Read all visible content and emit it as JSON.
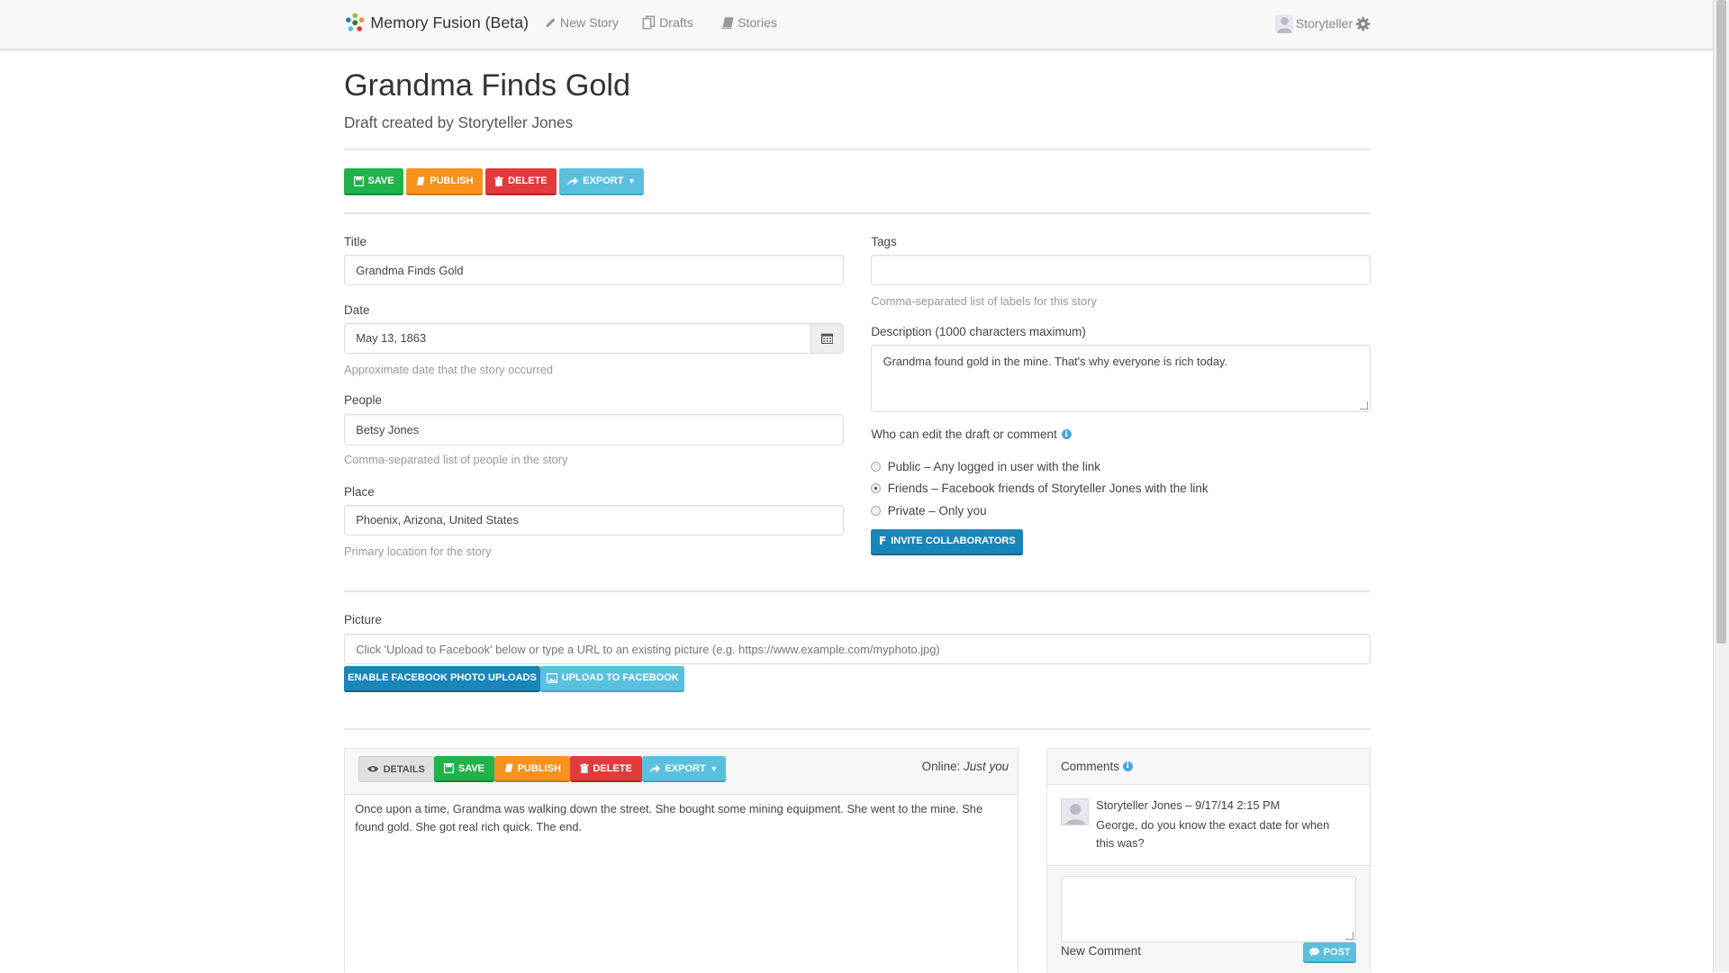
{
  "nav": {
    "brand": "Memory Fusion (Beta)",
    "new_story": "New Story",
    "drafts": "Drafts",
    "stories": "Stories",
    "user": "Storyteller"
  },
  "header": {
    "title": "Grandma Finds Gold",
    "subtitle": "Draft created by Storyteller Jones"
  },
  "toolbar": {
    "save": "SAVE",
    "publish": "PUBLISH",
    "delete": "DELETE",
    "export": "EXPORT"
  },
  "form": {
    "title_label": "Title",
    "title_value": "Grandma Finds Gold",
    "date_label": "Date",
    "date_value": "May 13, 1863",
    "date_help": "Approximate date that the story occurred",
    "people_label": "People",
    "people_value": "Betsy Jones",
    "people_help": "Comma-separated list of people in the story",
    "place_label": "Place",
    "place_value": "Phoenix, Arizona, United States",
    "place_help": "Primary location for the story",
    "tags_label": "Tags",
    "tags_value": "",
    "tags_help": "Comma-separated list of labels for this story",
    "description_label": "Description (1000 characters maximum)",
    "description_value": "Grandma found gold in the mine. That's why everyone is rich today.",
    "permissions_label": "Who can edit the draft or comment",
    "permission_public": "Public – Any logged in user with the link",
    "permission_friends": "Friends – Facebook friends of Storyteller Jones with the link",
    "permission_private": "Private – Only you",
    "permission_selected": "friends",
    "invite_button": "INVITE COLLABORATORS",
    "picture_label": "Picture",
    "picture_placeholder": "Click 'Upload to Facebook' below or type a URL to an existing picture (e.g. https://www.example.com/myphoto.jpg)",
    "enable_uploads_button": "ENABLE FACEBOOK PHOTO UPLOADS",
    "upload_button": "UPLOAD TO FACEBOOK"
  },
  "editor": {
    "details": "DETAILS",
    "save": "SAVE",
    "publish": "PUBLISH",
    "delete": "DELETE",
    "export": "EXPORT",
    "online_label": "Online:",
    "online_value": "Just you",
    "text": "Once upon a time, Grandma was walking down the street. She bought some mining equipment. She went to the mine. She found gold. She got real rich quick.  The end."
  },
  "comments": {
    "title": "Comments",
    "items": [
      {
        "author_time": "Storyteller Jones – 9/17/14 2:15 PM",
        "text": "George, do you know the exact date for when this was?"
      }
    ],
    "new_comment_label": "New Comment",
    "post_button": "POST"
  },
  "colors": {
    "green": "#22b24c",
    "orange": "#f7921e",
    "red": "#e23b3b",
    "light_blue": "#5bc0de",
    "dark_blue": "#1a85b8"
  }
}
